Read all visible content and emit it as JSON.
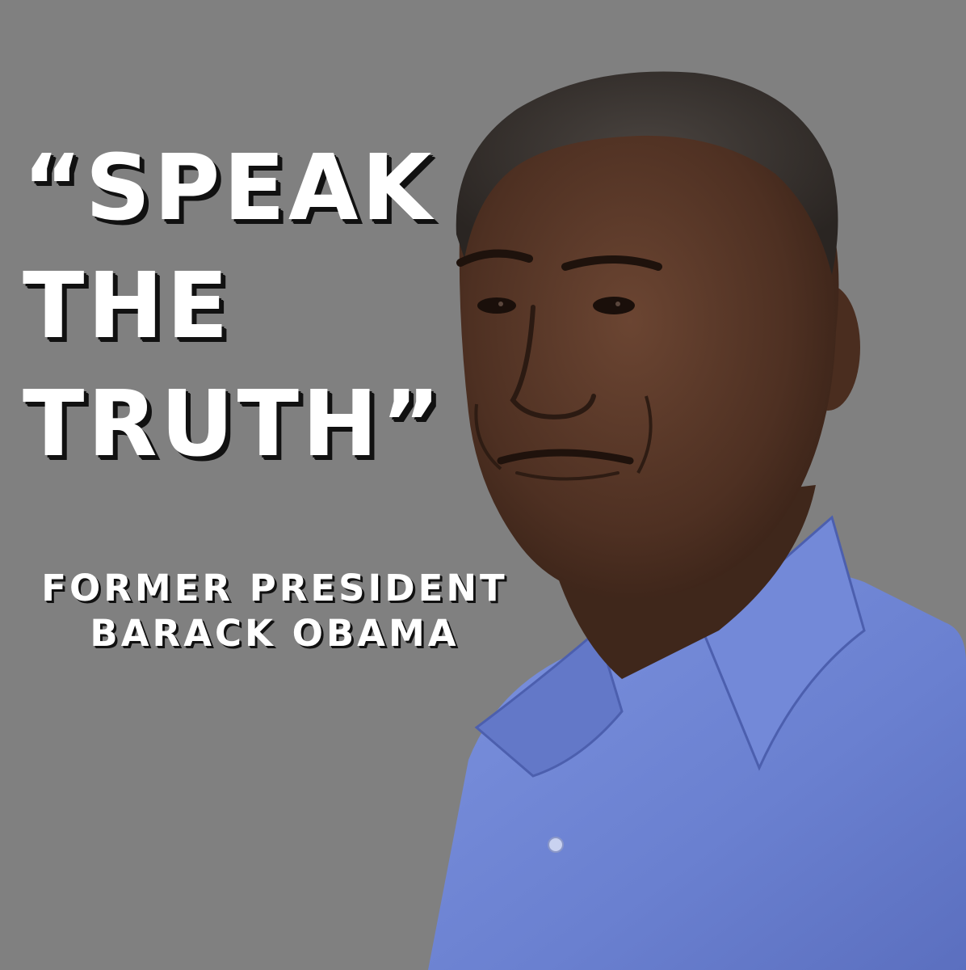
{
  "poster": {
    "background_color": "#808080",
    "quote_lines": [
      "“SPEAK",
      "THE",
      "TRUTH”"
    ],
    "attribution_lines": [
      "FORMER PRESIDENT",
      "BARACK OBAMA"
    ],
    "portrait": {
      "shirt_color": "#6f86d6",
      "skin_color": "#5a3a2a",
      "hair_color": "#2f2a27"
    }
  }
}
